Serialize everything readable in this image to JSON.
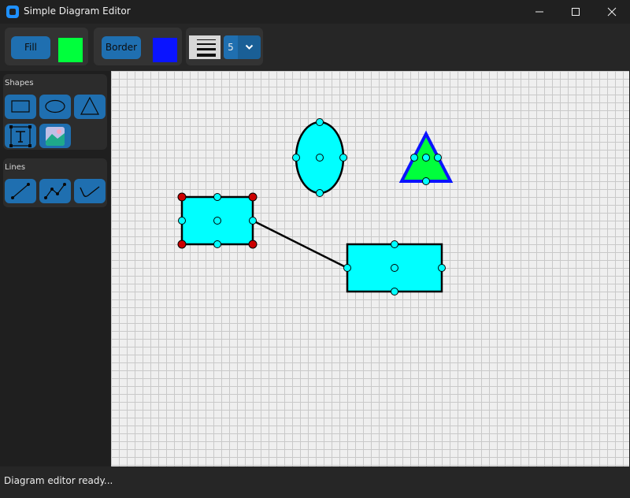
{
  "window": {
    "title": "Simple Diagram Editor"
  },
  "toolbar": {
    "fill_label": "Fill",
    "fill_color": "#00ff3c",
    "border_label": "Border",
    "border_color": "#0a14ff",
    "line_width": "5"
  },
  "sidebar": {
    "shapes_label": "Shapes",
    "lines_label": "Lines",
    "shape_tools": [
      "rectangle-icon",
      "ellipse-icon",
      "triangle-icon",
      "text-icon",
      "image-icon"
    ],
    "line_tools": [
      "line-icon",
      "polyline-icon",
      "curve-icon"
    ]
  },
  "canvas": {
    "shape_fill": "#00ffff",
    "triangle_fill": "#00ff3c",
    "triangle_border": "#0a14ff",
    "selection_handle": "#cc0000"
  },
  "status": {
    "text": "Diagram editor ready..."
  }
}
